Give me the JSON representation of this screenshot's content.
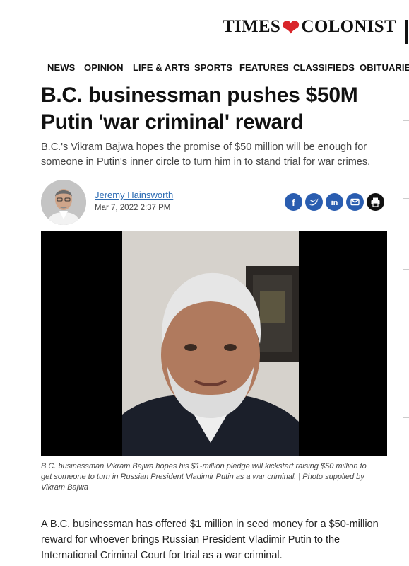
{
  "masthead": {
    "logo_left": "TIMES",
    "logo_right": "COLONIST"
  },
  "nav": [
    "NEWS",
    "OPINION",
    "LIFE & ARTS",
    "SPORTS",
    "FEATURES",
    "CLASSIFIEDS",
    "OBITUARIES"
  ],
  "article": {
    "headline_line1": "B.C. businessman pushes $50M",
    "headline_line2": "Putin 'war criminal' reward",
    "dek": "B.C.'s Vikram Bajwa hopes the promise of $50 million will be enough for someone in Putin's inner circle to turn him in to stand trial for war crimes.",
    "author": "Jeremy Hainsworth",
    "date": "Mar 7, 2022 2:37 PM",
    "share_icons": [
      "facebook-icon",
      "twitter-icon",
      "linkedin-icon",
      "email-icon",
      "print-icon"
    ],
    "share_color": "#2a5db0",
    "caption": "B.C. businessman Vikram Bajwa hopes his $1-million pledge will kickstart raising $50 million to get someone to turn in Russian President Vladimir Putin as a war criminal. | Photo supplied by Vikram Bajwa",
    "body_first_paragraph": "A B.C. businessman has offered $1 million in seed money for a $50-million reward for whoever brings Russian President Vladimir Putin to the International Criminal Court for trial as a war criminal."
  },
  "colors": {
    "brand_red": "#d9262b",
    "link_blue": "#2a6ab3"
  }
}
